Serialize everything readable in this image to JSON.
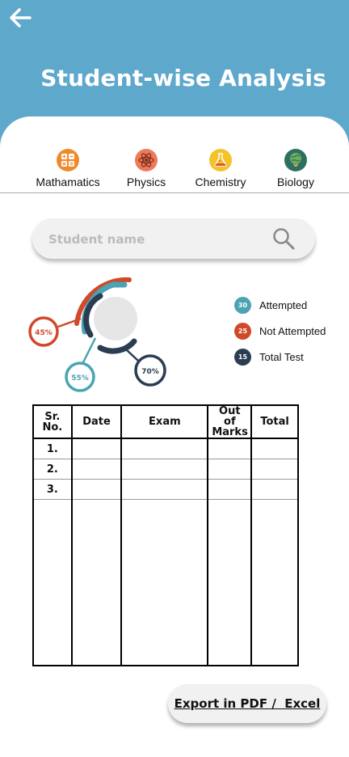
{
  "header": {
    "title": "Student-wise Analysis",
    "background": "#5ea8cb"
  },
  "subjects": [
    {
      "label": "Mathamatics",
      "icon": "calculator-icon",
      "color": "#ee8a2c"
    },
    {
      "label": "Physics",
      "icon": "atom-icon",
      "color": "#ef7a5b"
    },
    {
      "label": "Chemistry",
      "icon": "flask-icon",
      "color": "#f4c32a"
    },
    {
      "label": "Biology",
      "icon": "brain-icon",
      "color": "#3a8f7d"
    }
  ],
  "search": {
    "placeholder": "Student name"
  },
  "donut": {
    "labels": [
      "45%",
      "55%",
      "70%"
    ],
    "values": [
      45,
      55,
      70
    ],
    "colors": [
      "#d0492a",
      "#4ba3b3",
      "#2b3d52"
    ]
  },
  "legend": [
    {
      "count": "30",
      "label": "Attempted",
      "color": "#4ba3b3"
    },
    {
      "count": "25",
      "label": "Not Attempted",
      "color": "#d0492a"
    },
    {
      "count": "15",
      "label": "Total Test",
      "color": "#2b3d52"
    }
  ],
  "table": {
    "headers": [
      "Sr. No.",
      "Date",
      "Exam",
      "Out of Marks",
      "Total"
    ],
    "rows": [
      {
        "sr": "1.",
        "date": "",
        "exam": "",
        "out_of": "",
        "total": ""
      },
      {
        "sr": "2.",
        "date": "",
        "exam": "",
        "out_of": "",
        "total": ""
      },
      {
        "sr": "3.",
        "date": "",
        "exam": "",
        "out_of": "",
        "total": ""
      }
    ]
  },
  "export": {
    "label": "Export in PDF /  Excel"
  }
}
